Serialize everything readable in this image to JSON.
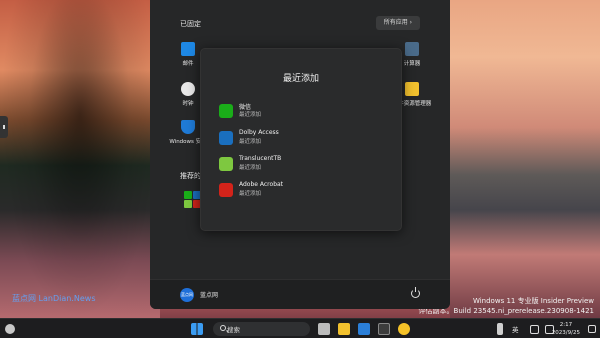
{
  "desktop": {
    "watermark": "蓝点网 LanDian.News",
    "version_line1": "Windows 11 专业版 Insider Preview",
    "version_line2": "评估副本。Build 23545.ni_prerelease.230908-1421"
  },
  "start_menu": {
    "pinned_title": "已固定",
    "all_apps_label": "所有应用  ›",
    "recommended_title": "推荐的",
    "pinned": [
      {
        "label": "邮件",
        "icon": "mail-icon",
        "color": "#1e88e5"
      },
      {
        "label": "时钟",
        "icon": "clock-icon",
        "color": "#e8e8e8"
      },
      {
        "label": "Windows 安全",
        "icon": "shield-icon",
        "color": "#1f7ad6"
      },
      {
        "label": "计算器",
        "icon": "calculator-icon",
        "color": "#4a6b8a"
      },
      {
        "label": "文件资源管理器",
        "icon": "folder-icon",
        "color": "#f2c12e"
      }
    ],
    "user": {
      "avatar_text": "蓝点网",
      "name": "蓝点网"
    }
  },
  "popup": {
    "title": "最近添加",
    "items": [
      {
        "name": "微信",
        "sub": "最近添加",
        "icon": "wechat-icon",
        "color": "#1aad19"
      },
      {
        "name": "Dolby Access",
        "sub": "最近添加",
        "icon": "dolby-icon",
        "color": "#1a6fbf"
      },
      {
        "name": "TranslucentTB",
        "sub": "最近添加",
        "icon": "translucenttb-icon",
        "color": "#7ec840"
      },
      {
        "name": "Adobe Acrobat",
        "sub": "最近添加",
        "icon": "acrobat-icon",
        "color": "#d3231a"
      }
    ]
  },
  "taskbar": {
    "search_placeholder": "搜索",
    "ime": "英",
    "time": "2:17",
    "date": "2023/9/25"
  }
}
